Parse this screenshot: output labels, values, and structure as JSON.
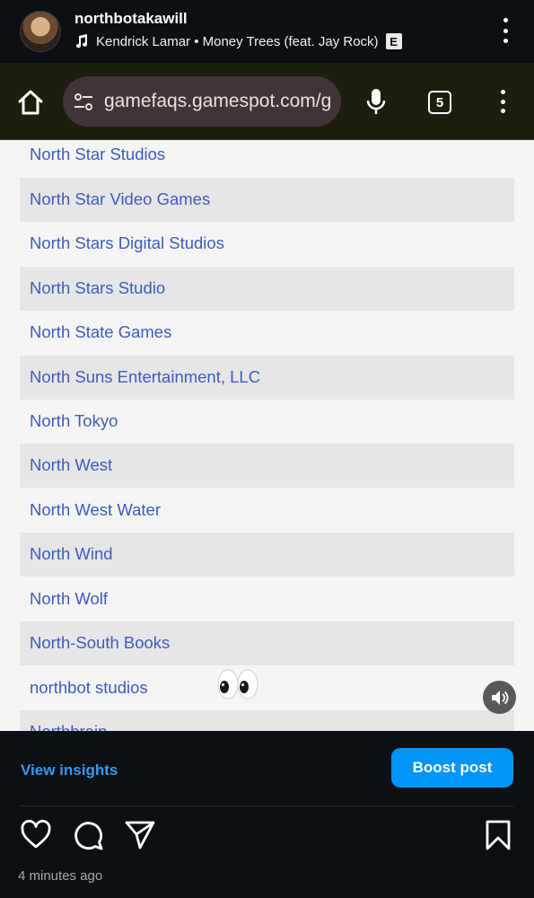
{
  "header": {
    "username": "northbotakawill",
    "music": "Kendrick Lamar • Money Trees (feat. Jay Rock)",
    "explicit_badge": "E"
  },
  "browser": {
    "url": "gamefaqs.gamespot.com/g",
    "tab_count": "5"
  },
  "list": {
    "items": [
      "North Star Studios",
      "North Star Video Games",
      "North Stars Digital Studios",
      "North Stars Studio",
      "North State Games",
      "North Suns Entertainment, LLC",
      "North Tokyo",
      "North West",
      "North West Water",
      "North Wind",
      "North Wolf",
      "North-South Books",
      "northbot studios",
      "Northbrain"
    ]
  },
  "overlay": {
    "sticker": "eyes-emoji"
  },
  "post": {
    "insights_label": "View insights",
    "boost_label": "Boost post",
    "timestamp": "4 minutes ago"
  },
  "colors": {
    "link": "#3c5cbf",
    "accent_blue": "#0095f6",
    "insights_blue": "#3797f0",
    "background_dark": "#0c1014"
  }
}
